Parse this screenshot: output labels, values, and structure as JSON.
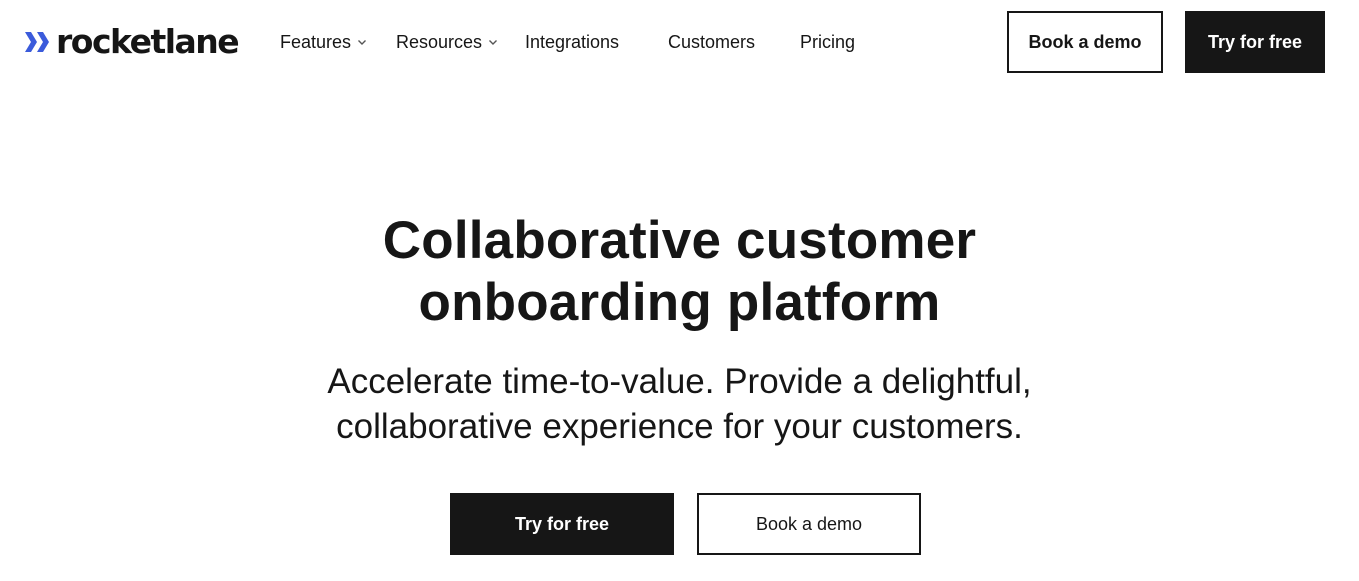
{
  "brand": {
    "name": "rocketlane",
    "mark_color": "#3b5bdb"
  },
  "nav": {
    "items": [
      {
        "label": "Features",
        "has_dropdown": true
      },
      {
        "label": "Resources",
        "has_dropdown": true
      },
      {
        "label": "Integrations",
        "has_dropdown": false
      },
      {
        "label": "Customers",
        "has_dropdown": false
      },
      {
        "label": "Pricing",
        "has_dropdown": false
      }
    ],
    "book_demo_label": "Book a demo",
    "try_free_label": "Try for free"
  },
  "hero": {
    "title_line1": "Collaborative customer",
    "title_line2": "onboarding platform",
    "subtitle_line1": "Accelerate time-to-value. Provide a delightful,",
    "subtitle_line2": "collaborative experience for your customers.",
    "try_free_label": "Try for free",
    "book_demo_label": "Book a demo"
  },
  "colors": {
    "text": "#161616",
    "background": "#ffffff",
    "accent": "#3b5bdb"
  }
}
